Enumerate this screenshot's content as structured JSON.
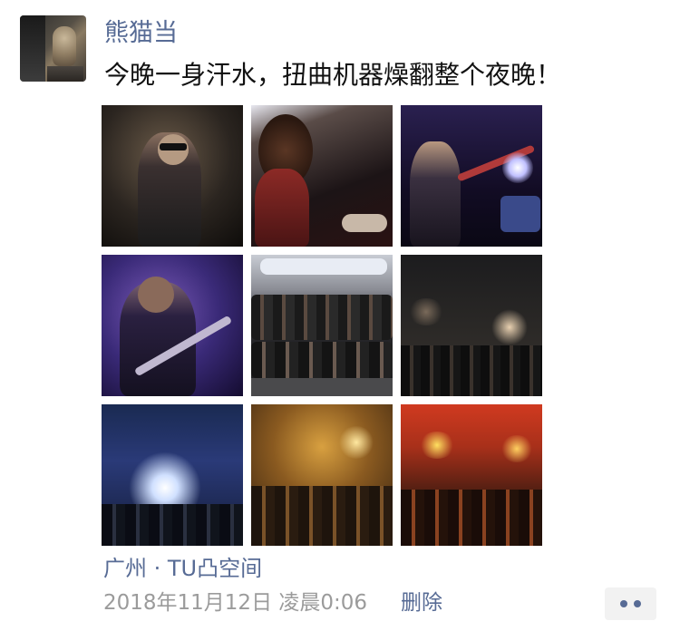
{
  "post": {
    "username": "熊猫当",
    "text": "今晚一身汗水，扭曲机器燥翻整个夜晚！",
    "location": "广州 · TU凸空间",
    "timestamp": "2018年11月12日 凌晨0:06",
    "delete_label": "删除"
  },
  "avatar": {
    "icon": "cat-photo"
  },
  "photos": [
    {
      "icon": "rapper-with-sunglasses-photo"
    },
    {
      "icon": "curly-hair-guitarist-photo"
    },
    {
      "icon": "bassist-on-stage-photo"
    },
    {
      "icon": "guitarist-purple-light-photo"
    },
    {
      "icon": "band-crowd-group-photo"
    },
    {
      "icon": "dark-crowd-hands-photo"
    },
    {
      "icon": "bright-stage-lights-crowd-photo"
    },
    {
      "icon": "yellow-light-crowd-photo"
    },
    {
      "icon": "red-light-stage-crowd-photo"
    }
  ],
  "more_button": {
    "icon": "more-dots-icon"
  }
}
